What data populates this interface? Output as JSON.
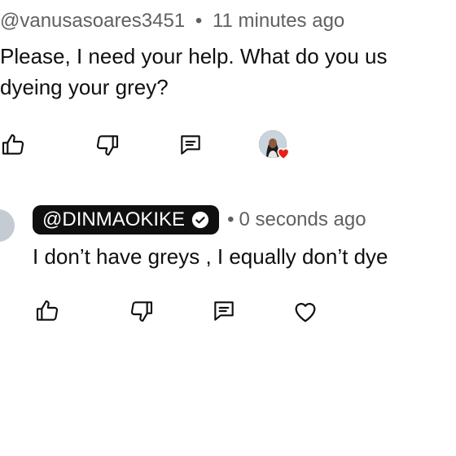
{
  "comment": {
    "username": "@vanusasoares3451",
    "time": "11 minutes ago",
    "text_line1": "Please, I need your help. What do you us",
    "text_line2": "dyeing your grey?"
  },
  "reply": {
    "username": "@DINMAOKIKE",
    "time": "0 seconds ago",
    "text": "I don’t have greys , I equally don’t dye"
  },
  "separator": "•",
  "colors": {
    "text": "#0f0f0f",
    "meta": "#606060",
    "badge_bg": "#0f0f0f",
    "heart": "#e62117"
  },
  "icons": {
    "like": "thumbs-up-icon",
    "dislike": "thumbs-down-icon",
    "reply": "comment-icon",
    "creator_heart": "heart-icon"
  }
}
